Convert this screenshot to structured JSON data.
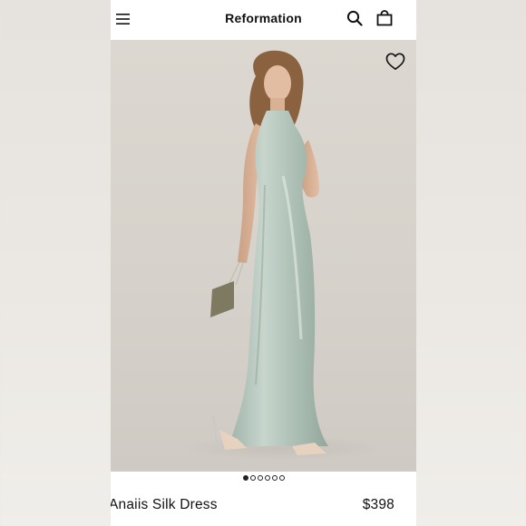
{
  "header": {
    "brand": "Reformation",
    "icons": {
      "menu": "hamburger-menu-icon",
      "search": "search-icon",
      "bag": "shopping-bag-icon"
    }
  },
  "gallery": {
    "wishlist_icon": "heart-outline-icon",
    "image_count": 6,
    "active_index": 0
  },
  "product": {
    "name": "Anaiis Silk Dress",
    "price": "$398"
  },
  "colors": {
    "dress": "#b6c6bd",
    "background": "#d8d4cd",
    "text": "#111111"
  }
}
